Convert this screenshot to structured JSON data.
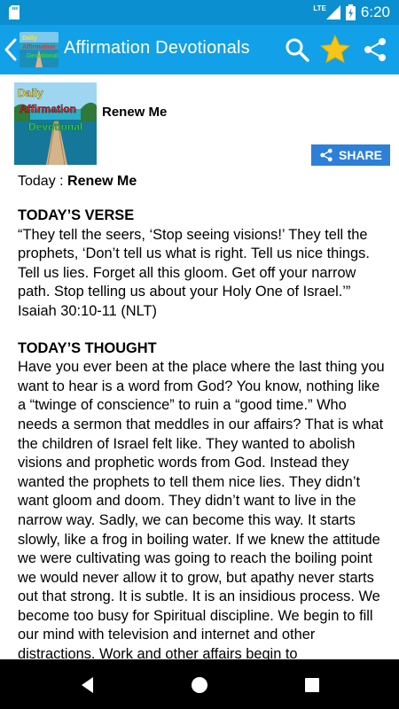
{
  "status_bar": {
    "network": "LTE",
    "time": "6:20"
  },
  "app_bar": {
    "title": "Affirmation Devotionals",
    "logo_text": [
      "Daily",
      "Affirmation",
      "Devotional"
    ]
  },
  "post": {
    "title": "Renew Me",
    "thumbnail_text": [
      "Daily",
      "Affirmation",
      "Devotional"
    ],
    "share_label": "SHARE",
    "today_label": "Today : ",
    "today_value": "Renew Me",
    "verse_heading": "TODAY’S VERSE",
    "verse_text": "“They tell the seers, ‘Stop seeing visions!’ They tell the prophets, ‘Don’t tell us what is right. Tell us nice things. Tell us lies. Forget all this gloom. Get off your narrow path. Stop telling us about your Holy One of Israel.’” Isaiah 30:10-11 (NLT)",
    "thought_heading": "TODAY’S THOUGHT",
    "thought_text": "Have you ever been at the place where the last thing you want to hear is a word from God? You know, nothing like a “twinge of conscience” to ruin a “good time.” Who needs a sermon that meddles in our affairs? That is what the children of Israel felt like. They wanted to abolish visions and prophetic words from God. Instead they wanted the prophets to tell them nice lies. They didn’t want gloom and doom. They didn’t want to live in the narrow way. Sadly, we can become this way. It starts slowly, like a frog in boiling water. If we knew the attitude we were cultivating was going to reach the boiling point we would never allow it to grow, but apathy never starts out that strong. It is subtle. It is an insidious process. We become too busy for Spiritual discipline. We begin to fill our mind with television and internet and other distractions. Work and other affairs begin to"
  },
  "colors": {
    "status_bar": "#0b8fd0",
    "app_bar": "#12a0e8",
    "share_button": "#2e7fd8",
    "star": "#f5c518"
  }
}
